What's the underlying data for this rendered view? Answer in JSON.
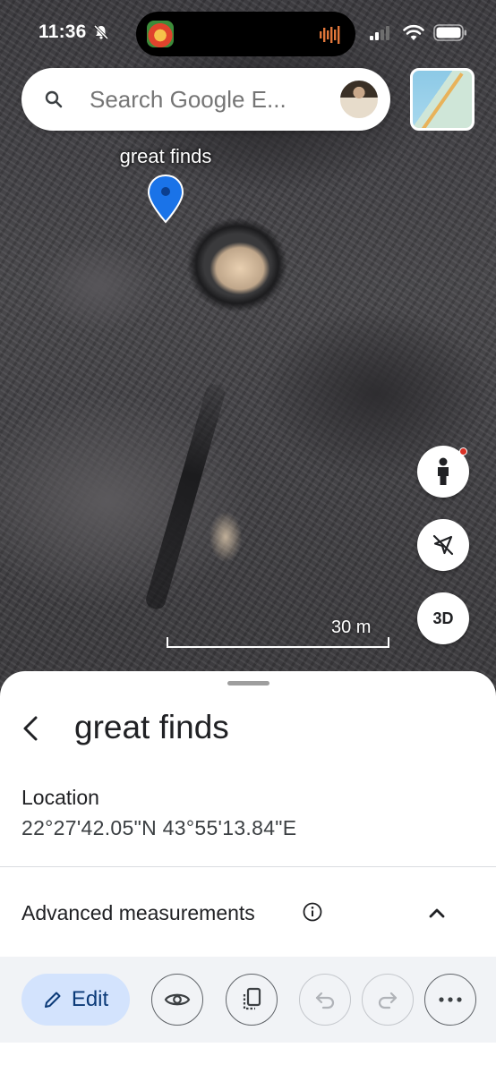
{
  "status_bar": {
    "time": "11:36"
  },
  "search": {
    "placeholder": "Search Google E..."
  },
  "placemark": {
    "label": "great finds",
    "pin_color": "#1a73e8"
  },
  "map_controls": {
    "pegman_icon": "pegman-icon",
    "compass_icon": "compass-off-icon",
    "view_3d_label": "3D"
  },
  "scale": {
    "label": "30 m"
  },
  "sheet": {
    "title": "great finds",
    "location_label": "Location",
    "location_value": "22°27'42.05\"N 43°55'13.84\"E",
    "advanced_label": "Advanced measurements"
  },
  "toolbar": {
    "edit_label": "Edit",
    "accent": "#d3e3fd",
    "icons": [
      "pencil-icon",
      "eye-icon",
      "copy-icon",
      "undo-icon",
      "redo-icon",
      "more-icon"
    ]
  }
}
